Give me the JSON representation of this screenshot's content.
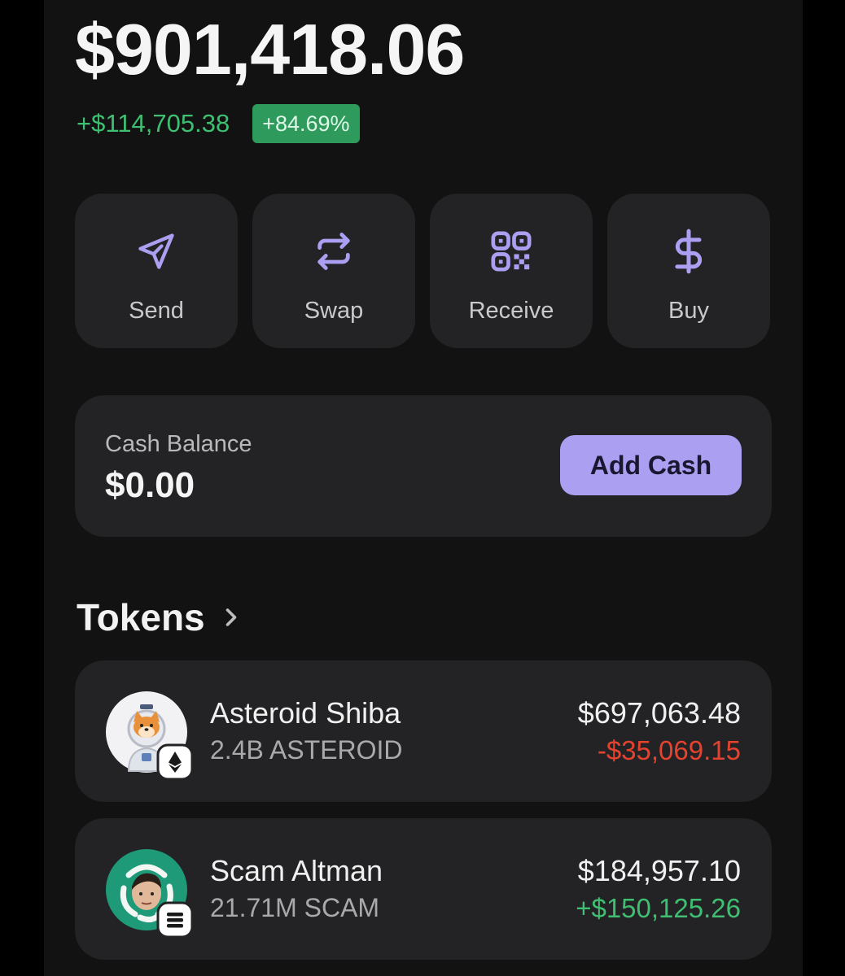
{
  "portfolio": {
    "total_value": "$901,418.06",
    "change_amount": "+$114,705.38",
    "change_percent": "+84.69%"
  },
  "actions": [
    {
      "label": "Send",
      "icon": "send-icon"
    },
    {
      "label": "Swap",
      "icon": "swap-icon"
    },
    {
      "label": "Receive",
      "icon": "qr-code-icon"
    },
    {
      "label": "Buy",
      "icon": "dollar-icon"
    }
  ],
  "cash": {
    "label": "Cash Balance",
    "value": "$0.00",
    "button_label": "Add Cash"
  },
  "tokens": {
    "title": "Tokens",
    "items": [
      {
        "name": "Asteroid Shiba",
        "quantity": "2.4B ASTEROID",
        "value": "$697,063.48",
        "change": "-$35,069.15",
        "direction": "negative",
        "chain_icon": "ethereum-icon"
      },
      {
        "name": "Scam Altman",
        "quantity": "21.71M SCAM",
        "value": "$184,957.10",
        "change": "+$150,125.26",
        "direction": "positive",
        "chain_icon": "solana-icon"
      }
    ]
  },
  "colors": {
    "accent": "#ab9ff2",
    "positive": "#3fbf72",
    "negative": "#e5432f",
    "card": "#232325",
    "background": "#121212"
  }
}
